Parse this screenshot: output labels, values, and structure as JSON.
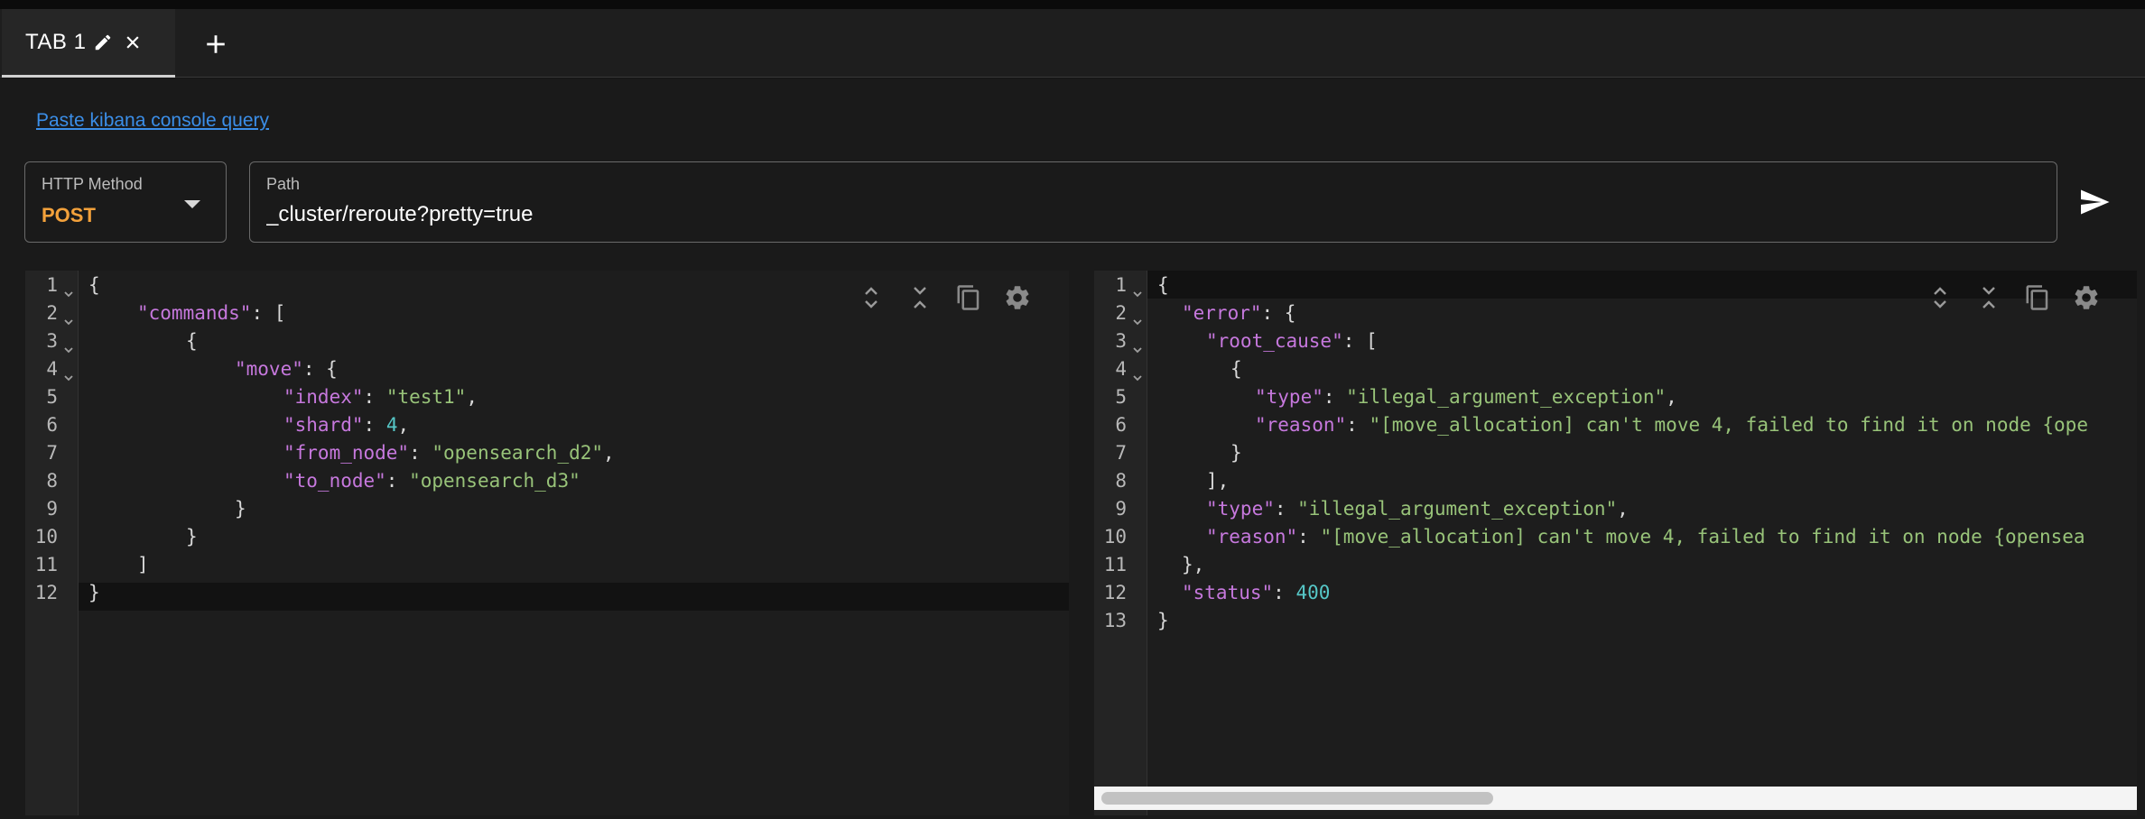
{
  "tabs": [
    {
      "label": "TAB 1",
      "active": true
    }
  ],
  "paste_link": "Paste kibana console query",
  "http_method": {
    "label": "HTTP Method",
    "value": "POST",
    "accent": "#f3a13b"
  },
  "path": {
    "label": "Path",
    "value": "_cluster/reroute?pretty=true"
  },
  "request_editor": {
    "lines": [
      {
        "num": "1",
        "fold": true
      },
      {
        "num": "2",
        "fold": true
      },
      {
        "num": "3",
        "fold": true
      },
      {
        "num": "4",
        "fold": true
      },
      {
        "num": "5",
        "fold": false
      },
      {
        "num": "6",
        "fold": false
      },
      {
        "num": "7",
        "fold": false
      },
      {
        "num": "8",
        "fold": false
      },
      {
        "num": "9",
        "fold": false
      },
      {
        "num": "10",
        "fold": false
      },
      {
        "num": "11",
        "fold": false
      },
      {
        "num": "12",
        "fold": false
      }
    ],
    "code": {
      "l1": "{",
      "l2_key": "\"commands\"",
      "l2_rest": ": [",
      "l3": "{",
      "l4_key": "\"move\"",
      "l4_rest": ": {",
      "l5_key": "\"index\"",
      "l5_sep": ": ",
      "l5_val": "\"test1\"",
      "l5_end": ",",
      "l6_key": "\"shard\"",
      "l6_sep": ": ",
      "l6_val": "4",
      "l6_end": ",",
      "l7_key": "\"from_node\"",
      "l7_sep": ": ",
      "l7_val": "\"opensearch_d2\"",
      "l7_end": ",",
      "l8_key": "\"to_node\"",
      "l8_sep": ": ",
      "l8_val": "\"opensearch_d3\"",
      "l9": "}",
      "l10": "}",
      "l11": "]",
      "l12": "}"
    }
  },
  "response_editor": {
    "lines": [
      {
        "num": "1",
        "fold": true
      },
      {
        "num": "2",
        "fold": true
      },
      {
        "num": "3",
        "fold": true
      },
      {
        "num": "4",
        "fold": true
      },
      {
        "num": "5",
        "fold": false
      },
      {
        "num": "6",
        "fold": false
      },
      {
        "num": "7",
        "fold": false
      },
      {
        "num": "8",
        "fold": false
      },
      {
        "num": "9",
        "fold": false
      },
      {
        "num": "10",
        "fold": false
      },
      {
        "num": "11",
        "fold": false
      },
      {
        "num": "12",
        "fold": false
      },
      {
        "num": "13",
        "fold": false
      }
    ],
    "code": {
      "l1": "{",
      "l2_key": "\"error\"",
      "l2_rest": ": {",
      "l3_key": "\"root_cause\"",
      "l3_rest": ": [",
      "l4": "{",
      "l5_key": "\"type\"",
      "l5_sep": ": ",
      "l5_val": "\"illegal_argument_exception\"",
      "l5_end": ",",
      "l6_key": "\"reason\"",
      "l6_sep": ": ",
      "l6_val": "\"[move_allocation] can't move 4, failed to find it on node {ope",
      "l7": "}",
      "l8": "],",
      "l9_key": "\"type\"",
      "l9_sep": ": ",
      "l9_val": "\"illegal_argument_exception\"",
      "l9_end": ",",
      "l10_key": "\"reason\"",
      "l10_sep": ": ",
      "l10_val": "\"[move_allocation] can't move 4, failed to find it on node {opensea",
      "l11": "},",
      "l12_key": "\"status\"",
      "l12_sep": ": ",
      "l12_val": "400",
      "l13": "}"
    }
  },
  "editor_tools": [
    "expand-all-icon",
    "collapse-all-icon",
    "copy-icon",
    "settings-icon"
  ],
  "colors": {
    "key": "#c678dd",
    "string": "#98c379",
    "number": "#56c7c7",
    "link": "#3b8ee8",
    "method": "#f3a13b"
  }
}
